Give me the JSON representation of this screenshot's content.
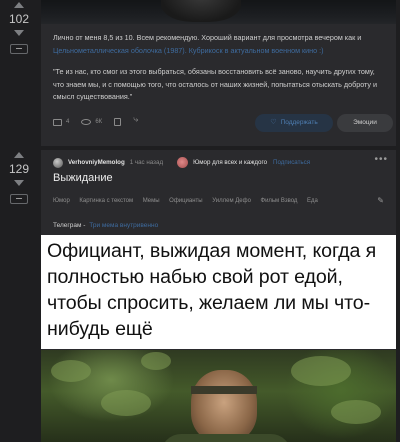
{
  "story1": {
    "rating": "102",
    "text_line1": "Лично от меня 8,5 из 10. Всем рекомендую. Хороший вариант для просмотра вечером как и",
    "text_link": "Цельнометаллическая оболочка (1987). Кубрикоск в актуальном военном кино :)",
    "quote": "\"Те из нас, кто смог из этого выбраться, обязаны восстановить всё заново, научить других тому, что знаем мы, и с помощью того, что осталось от наших жизней, попытаться отыскать доброту и смысл существования.\"",
    "comments": "4",
    "views": "6К",
    "support_button": "Поддержать",
    "emotion_button": "Эмоции"
  },
  "story2": {
    "rating": "129",
    "author": "VerhovniyMemolog",
    "time": "1 час назад",
    "community": "Юмор для всех и каждого",
    "subscribe": "Подписаться",
    "title": "Выжидание",
    "tags": [
      "Юмор",
      "Картинка с текстом",
      "Мемы",
      "Официанты",
      "Уиллем Дефо",
      "Фильм Взвод",
      "Еда"
    ],
    "telegram_label": "Телеграм -",
    "telegram_link": "Три мема внутривенно",
    "meme_text": "Официант, выжидая момент, когда я полностью набью свой рот едой, чтобы спросить, желаем ли мы что-нибудь ещё"
  },
  "colors": {
    "background": "#1e1e20",
    "card": "#2a2a2d",
    "link": "#3e6b9e"
  }
}
